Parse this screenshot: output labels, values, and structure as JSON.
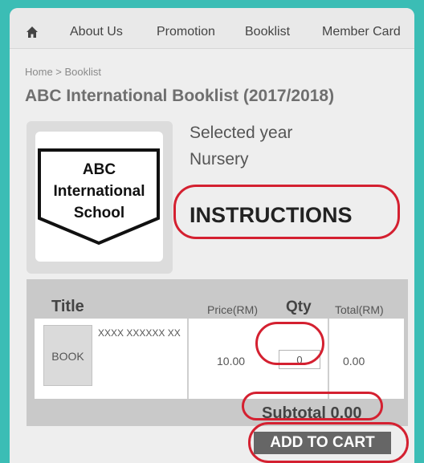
{
  "nav": {
    "home_icon": "home-icon",
    "items": [
      {
        "label": "About Us"
      },
      {
        "label": "Promotion"
      },
      {
        "label": "Booklist"
      },
      {
        "label": "Member Card"
      }
    ]
  },
  "breadcrumb": "Home > Booklist",
  "page_title": "ABC International Booklist (2017/2018)",
  "logo": {
    "line1": "ABC",
    "line2": "International",
    "line3": "School"
  },
  "selection": {
    "label": "Selected year",
    "value": "Nursery"
  },
  "instructions_label": "INSTRUCTIONS",
  "table": {
    "headers": {
      "title": "Title",
      "price": "Price(RM)",
      "qty": "Qty",
      "total": "Total(RM)"
    },
    "rows": [
      {
        "thumb_label": "BOOK",
        "name": "XXXX XXXXXX XX",
        "price": "10.00",
        "qty": "0",
        "total": "0.00"
      }
    ],
    "subtotal": "Subtotal 0.00"
  },
  "add_to_cart_label": "ADD TO CART",
  "colors": {
    "background": "#3bbdb5",
    "highlight_ring": "#d42030",
    "button": "#666666"
  }
}
